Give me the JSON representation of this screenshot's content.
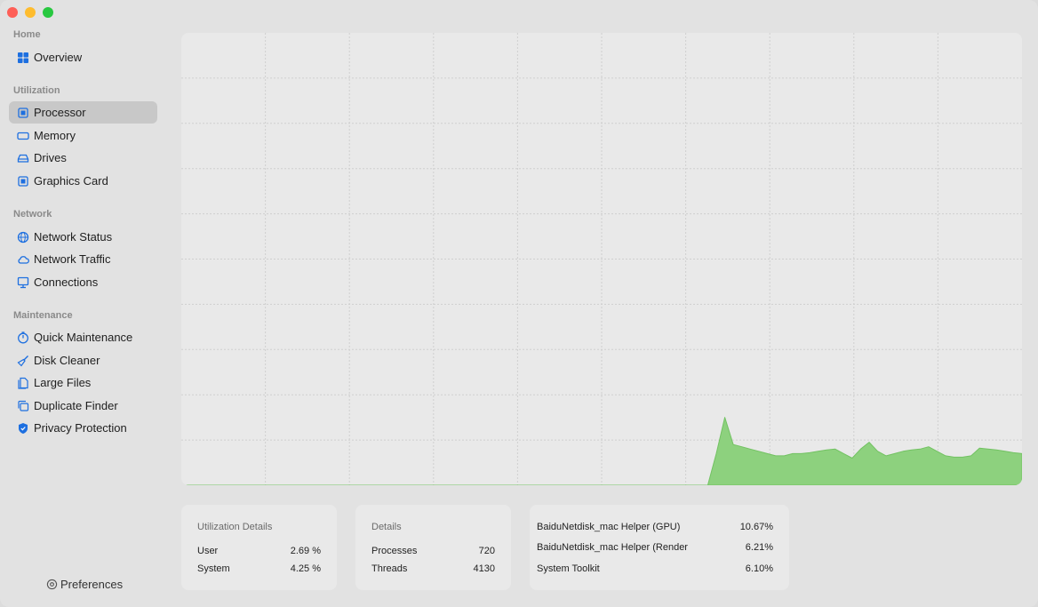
{
  "sidebar": {
    "sections": {
      "home": "Home",
      "utilization": "Utilization",
      "network": "Network",
      "maintenance": "Maintenance"
    },
    "items": {
      "overview": "Overview",
      "processor": "Processor",
      "memory": "Memory",
      "drives": "Drives",
      "graphics": "Graphics Card",
      "network_status": "Network Status",
      "network_traffic": "Network Traffic",
      "connections": "Connections",
      "quick_maintenance": "Quick Maintenance",
      "disk_cleaner": "Disk Cleaner",
      "large_files": "Large Files",
      "duplicate_finder": "Duplicate Finder",
      "privacy_protection": "Privacy Protection"
    },
    "selected": "processor",
    "preferences": "Preferences"
  },
  "colors": {
    "accent": "#1d6fe0",
    "chart_fill": "#8dd17e",
    "chart_line": "#72c262"
  },
  "chart_data": {
    "type": "area",
    "ylim": [
      0,
      100
    ],
    "grid": true,
    "x": [
      0,
      1,
      2,
      3,
      4,
      5,
      6,
      7,
      8,
      9,
      10,
      11,
      12,
      13,
      14,
      15,
      16,
      17,
      18,
      19,
      20,
      21,
      22,
      23,
      24,
      25,
      26,
      27,
      28,
      29,
      30,
      31,
      32,
      33,
      34,
      35,
      36,
      37,
      38,
      39,
      40,
      41,
      42,
      43,
      44,
      45,
      46,
      47,
      48,
      49,
      50,
      51,
      52,
      53,
      54,
      55,
      56,
      57,
      58,
      59,
      60,
      61,
      62,
      63,
      64,
      65,
      66,
      67,
      68,
      69,
      70,
      71,
      72,
      73,
      74,
      75,
      76,
      77,
      78,
      79,
      80,
      81,
      82,
      83,
      84,
      85,
      86,
      87,
      88,
      89,
      90,
      91,
      92,
      93,
      94,
      95,
      96,
      97,
      98,
      99
    ],
    "series": [
      {
        "values": [
          0,
          0,
          0,
          0,
          0,
          0,
          0,
          0,
          0,
          0,
          0,
          0,
          0,
          0,
          0,
          0,
          0,
          0,
          0,
          0,
          0,
          0,
          0,
          0,
          0,
          0,
          0,
          0,
          0,
          0,
          0,
          0,
          0,
          0,
          0,
          0,
          0,
          0,
          0,
          0,
          0,
          0,
          0,
          0,
          0,
          0,
          0,
          0,
          0,
          0,
          0,
          0,
          0,
          0,
          0,
          0,
          0,
          0,
          0,
          0,
          0,
          0,
          0,
          7,
          15,
          9,
          8.5,
          8,
          7.5,
          7,
          6.5,
          6.5,
          7,
          7,
          7.2,
          7.5,
          7.8,
          8,
          7,
          6,
          8,
          9.5,
          7.5,
          6.5,
          7,
          7.5,
          7.8,
          8,
          8.5,
          7.5,
          6.5,
          6.2,
          6.2,
          6.5,
          8.2,
          8,
          7.8,
          7.5,
          7.2,
          7
        ]
      }
    ]
  },
  "utilization": {
    "title": "Utilization Details",
    "rows": [
      {
        "label": "User",
        "value": "2.69 %"
      },
      {
        "label": "System",
        "value": "4.25 %"
      }
    ]
  },
  "details": {
    "title": "Details",
    "rows": [
      {
        "label": "Processes",
        "value": "720"
      },
      {
        "label": "Threads",
        "value": "4130"
      }
    ]
  },
  "top_processes": [
    {
      "name": "BaiduNetdisk_mac Helper (GPU)",
      "value": "10.67%"
    },
    {
      "name": "BaiduNetdisk_mac Helper (Render",
      "value": "6.21%"
    },
    {
      "name": "System Toolkit",
      "value": "6.10%"
    }
  ]
}
